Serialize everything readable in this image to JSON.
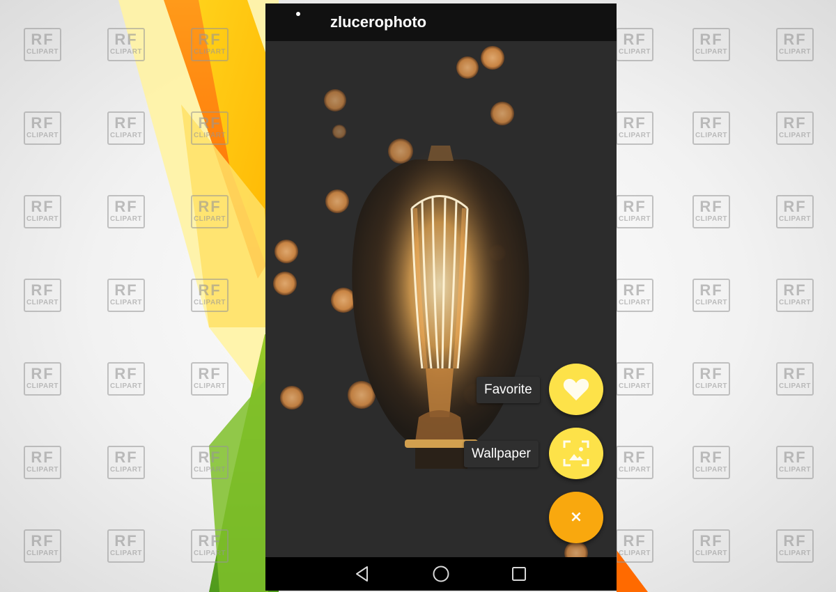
{
  "app": {
    "title": "zlucerophoto"
  },
  "speed_dial": {
    "favorite_label": "Favorite",
    "favorite_icon": "heart-icon",
    "wallpaper_label": "Wallpaper",
    "wallpaper_icon": "wallpaper-icon",
    "close_symbol": "×",
    "close_icon": "close-icon",
    "colors": {
      "action_fab": "#fde249",
      "main_fab": "#f9a80e",
      "label_background": "#2f2f2f"
    }
  },
  "navbar": {
    "back_icon": "back-triangle-icon",
    "home_icon": "home-circle-icon",
    "recents_icon": "recents-square-icon"
  },
  "watermark": {
    "line1": "RF",
    "line2": "CLIPART"
  },
  "photo": {
    "subject": "image-edison-bulb"
  }
}
